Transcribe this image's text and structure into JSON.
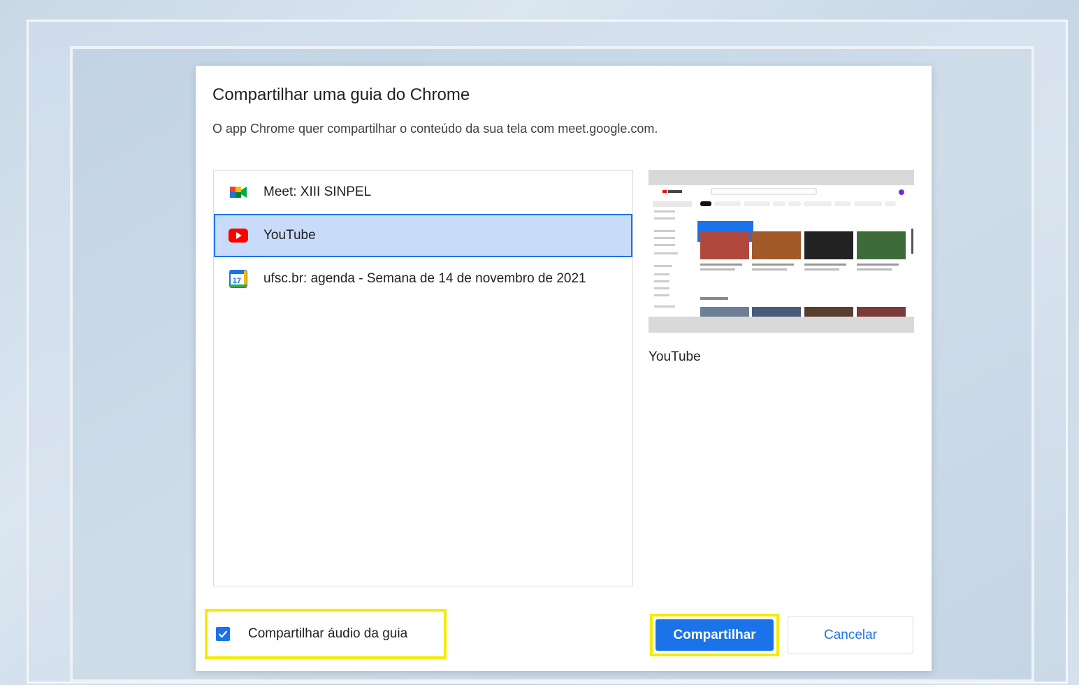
{
  "dialog": {
    "title": "Compartilhar uma guia do Chrome",
    "subtitle": "O app Chrome quer compartilhar o conteúdo da sua tela com meet.google.com."
  },
  "tabs": [
    {
      "label": "Meet: XIII SINPEL",
      "icon": "google-meet-icon",
      "selected": false
    },
    {
      "label": "YouTube",
      "icon": "youtube-icon",
      "selected": true
    },
    {
      "label": "ufsc.br: agenda - Semana de 14 de novembro de 2021",
      "icon": "google-calendar-icon",
      "selected": false,
      "icon_text": "17"
    }
  ],
  "preview": {
    "title": "YouTube"
  },
  "audio": {
    "label": "Compartilhar áudio da guia",
    "checked": true
  },
  "buttons": {
    "share": "Compartilhar",
    "cancel": "Cancelar"
  },
  "colors": {
    "accent": "#1a73e8",
    "selected_bg": "#c8dbf8",
    "highlight": "#f5ea00",
    "youtube_red": "#ff0000"
  }
}
